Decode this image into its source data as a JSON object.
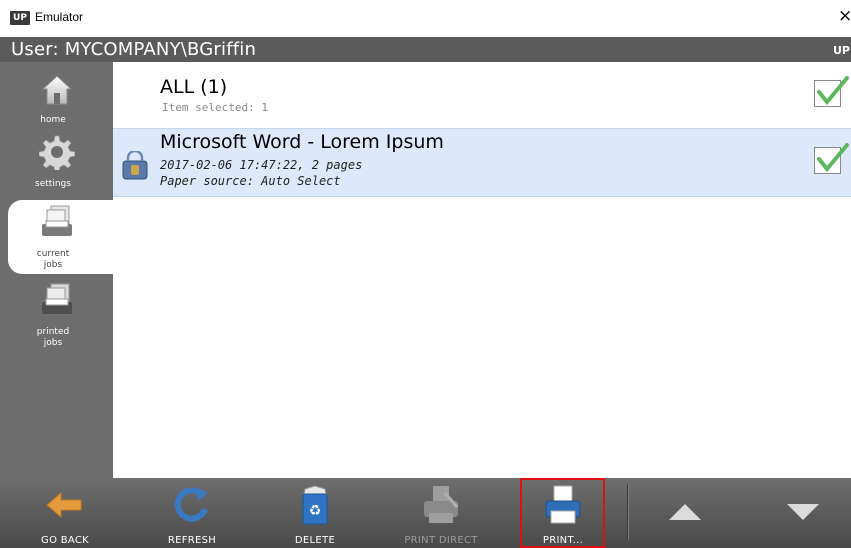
{
  "window": {
    "title": "Emulator",
    "close_glyph": "×",
    "app_icon_text": "UP"
  },
  "userbar": {
    "text": "User: MYCOMPANY\\BGriffin",
    "logo_text": "UP"
  },
  "sidebar": {
    "items": [
      {
        "label": "home",
        "icon": "home-icon",
        "active": false
      },
      {
        "label": "settings",
        "icon": "gear-icon",
        "active": false
      },
      {
        "label": "current\njobs",
        "icon": "current-jobs-icon",
        "active": true
      },
      {
        "label": "printed\njobs",
        "icon": "printed-jobs-icon",
        "active": false
      }
    ]
  },
  "list": {
    "all_title": "ALL (1)",
    "all_sub": "Item selected: 1",
    "jobs": [
      {
        "title": "Microsoft Word - Lorem Ipsum",
        "meta": "2017-02-06 17:47:22, 2 pages",
        "source": "Paper source: Auto Select",
        "selected": true
      }
    ]
  },
  "toolbar": {
    "go_back": "GO BACK",
    "refresh": "REFRESH",
    "delete": "DELETE",
    "print_direct": "PRINT DIRECT",
    "print": "PRINT..."
  },
  "colors": {
    "sidebar": "#6d6d6d",
    "userbar": "#5b5b5b",
    "selected_row": "#dde9fa",
    "highlight": "#e01010",
    "go_back_arrow": "#e59a3c",
    "refresh_arrow": "#3b78c2",
    "check_green": "#4caf50"
  }
}
